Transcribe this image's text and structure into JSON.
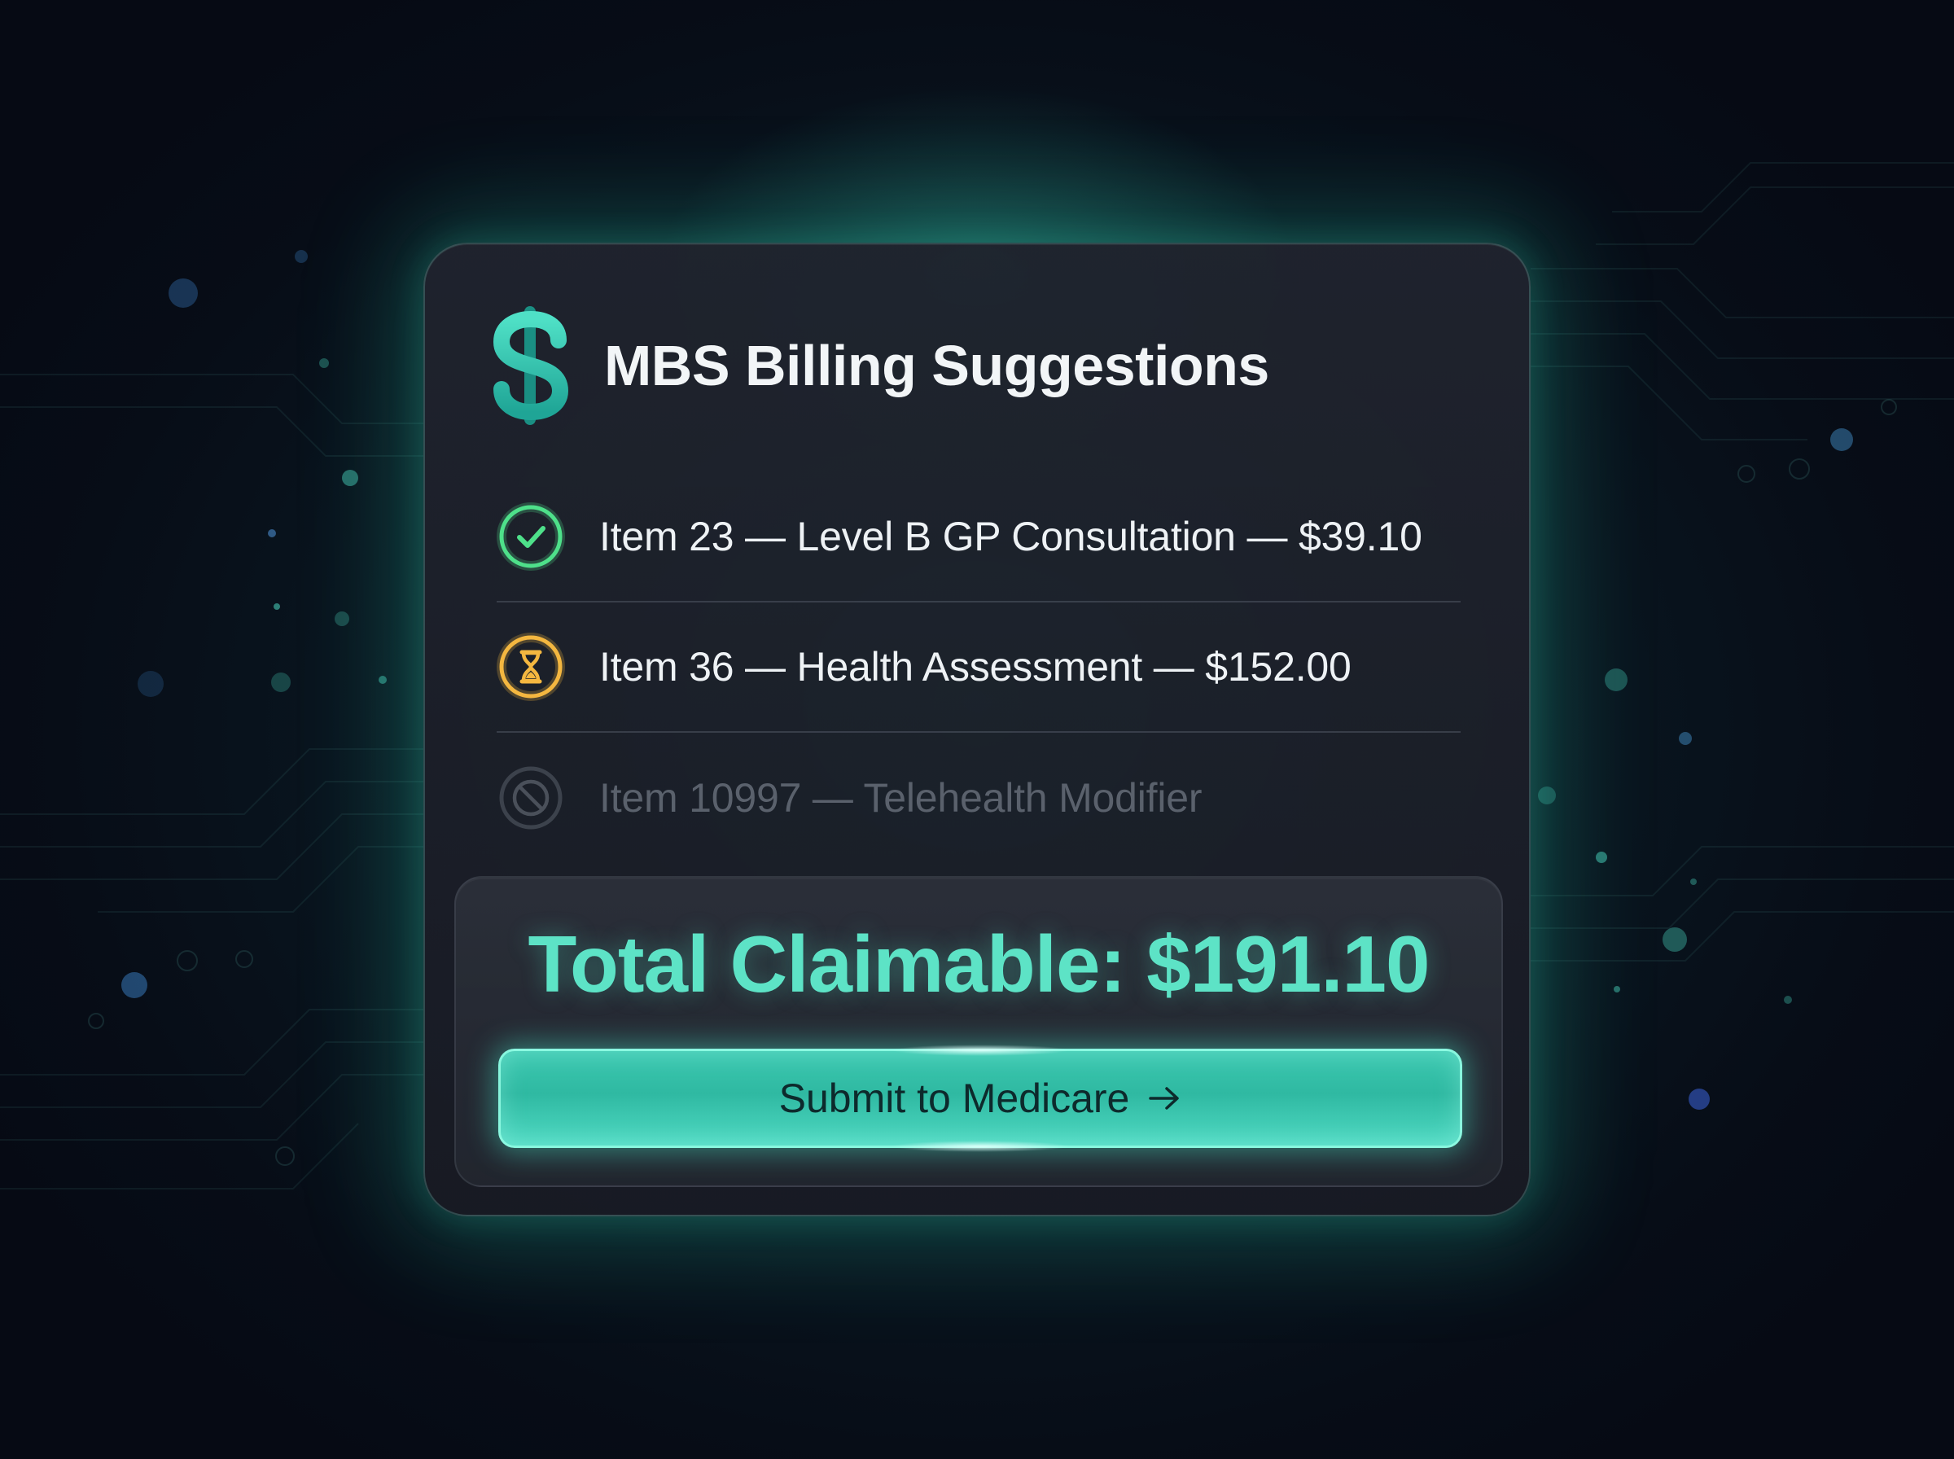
{
  "card": {
    "title": "MBS Billing Suggestions",
    "title_icon": "dollar-icon"
  },
  "items": [
    {
      "text": "Item 23 — Level B GP Consultation — $39.10",
      "status": "approved",
      "icon": "check-circle-icon"
    },
    {
      "text": "Item 36 — Health Assessment — $152.00",
      "status": "pending",
      "icon": "hourglass-icon"
    },
    {
      "text": "Item 10997 — Telehealth Modifier",
      "status": "not-applicable",
      "icon": "prohibited-icon"
    }
  ],
  "total": {
    "text": "Total Claimable: $191.10"
  },
  "submit": {
    "label": "Submit to Medicare",
    "icon": "arrow-right-icon"
  },
  "colors": {
    "accent": "#5de3c6",
    "approved": "#4ee08a",
    "pending": "#f4b740",
    "disabled": "#5a616c",
    "card_bg": "#1f222c",
    "page_bg": "#070d17"
  }
}
